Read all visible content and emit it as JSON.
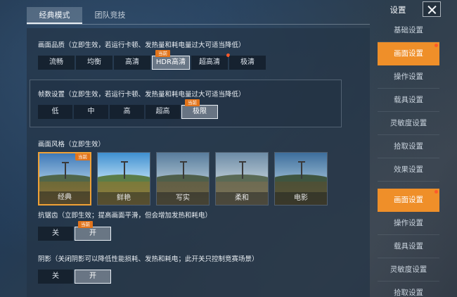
{
  "tabs": [
    {
      "label": "经典模式",
      "active": true
    },
    {
      "label": "团队竞技",
      "active": false
    }
  ],
  "graphics_quality": {
    "label": "画面品质（立即生效，若运行卡顿、发热量和耗电量过大可适当降低）",
    "options": [
      "流畅",
      "均衡",
      "高清",
      "HDR高清",
      "超高清",
      "极清"
    ],
    "selected": "HDR高清",
    "current_tag": "当前"
  },
  "frame_rate": {
    "label": "帧数设置（立即生效，若运行卡顿、发热量和耗电量过大可适当降低）",
    "options": [
      "低",
      "中",
      "高",
      "超高",
      "极限"
    ],
    "selected": "极限",
    "current_tag": "当前"
  },
  "style": {
    "label": "画面风格（立即生效）",
    "options": [
      "经典",
      "鲜艳",
      "写实",
      "柔和",
      "电影"
    ],
    "selected": "经典",
    "current_tag": "当前"
  },
  "anti_alias": {
    "label": "抗锯齿（立即生效；提高画面平滑，但会增加发热和耗电）",
    "off": "关",
    "on": "开",
    "selected": "开",
    "current_tag": "当前"
  },
  "shadow": {
    "label": "阴影（关闭阴影可以降低性能损耗、发热和耗电；此开关只控制竞赛场景）",
    "off": "关",
    "on": "开",
    "selected": "开"
  },
  "sidebar": {
    "title": "设置",
    "items": [
      "基础设置",
      "画面设置",
      "操作设置",
      "载具设置",
      "灵敏度设置",
      "拾取设置",
      "效果设置",
      "画面设置",
      "操作设置",
      "载具设置",
      "灵敏度设置",
      "拾取设置"
    ]
  },
  "colors": {
    "accent": "#ef8f29",
    "tag": "#e2741b",
    "badge": "#ff5a2a"
  }
}
